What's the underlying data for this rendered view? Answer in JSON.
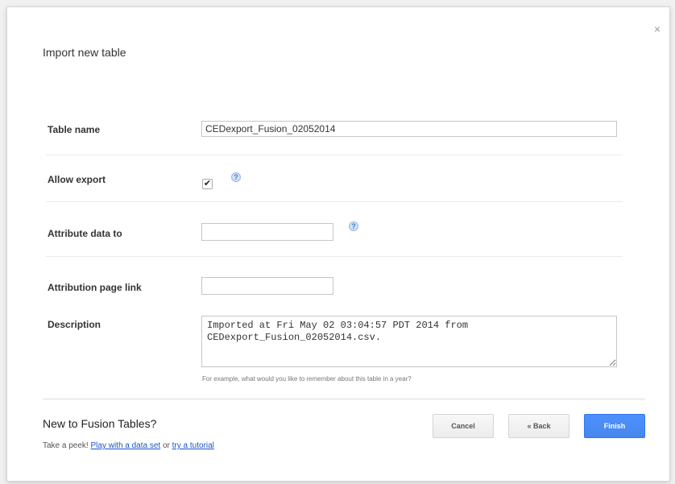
{
  "dialog": {
    "title": "Import new table",
    "close_glyph": "×"
  },
  "form": {
    "table_name": {
      "label": "Table name",
      "value": "CEDexport_Fusion_02052014"
    },
    "allow_export": {
      "label": "Allow export",
      "checked": true,
      "check_glyph": "✔",
      "help_glyph": "?"
    },
    "attribute": {
      "label": "Attribute data to",
      "value": "",
      "help_glyph": "?"
    },
    "attribution_link": {
      "label": "Attribution page link",
      "value": ""
    },
    "description": {
      "label": "Description",
      "value": "Imported at Fri May 02 03:04:57 PDT 2014 from CEDexport_Fusion_02052014.csv.",
      "hint": "For example, what would you like to remember about this table in a year?"
    }
  },
  "footer": {
    "heading": "New to Fusion Tables?",
    "peek_prefix": "Take a peek! ",
    "link_dataset": "Play with a data set",
    "peek_or": " or ",
    "link_tutorial": "try a tutorial"
  },
  "buttons": {
    "cancel": "Cancel",
    "back": "« Back",
    "finish": "Finish"
  },
  "colors": {
    "primary_button": "#4d90fe",
    "link": "#1a54c8"
  }
}
